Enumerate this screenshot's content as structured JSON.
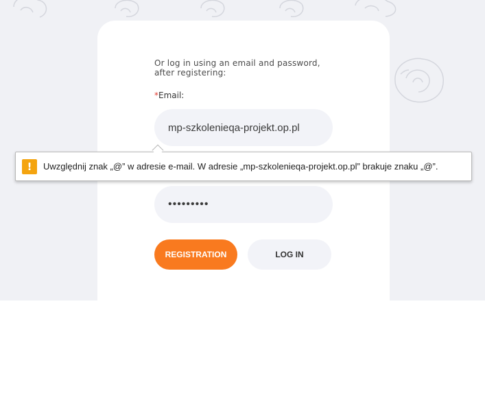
{
  "login_form": {
    "intro_text": "Or log in using an email and password, after registering:",
    "email_required_mark": "*",
    "email_label": "Email:",
    "email_value": "mp-szkolenieqa-projekt.op.pl",
    "password_value": "•••••••••",
    "registration_button": "REGISTRATION",
    "login_button": "LOG IN"
  },
  "validation_tooltip": {
    "icon": "warning-icon",
    "icon_glyph": "!",
    "message": "Uwzględnij znak „@” w adresie e-mail. W adresie „mp-szkolenieqa-projekt.op.pl” brakuje znaku „@”."
  },
  "colors": {
    "accent": "#f97a1f",
    "warning": "#f4a40f",
    "page_background": "#f0f1f5",
    "field_background": "#f2f3f8"
  }
}
